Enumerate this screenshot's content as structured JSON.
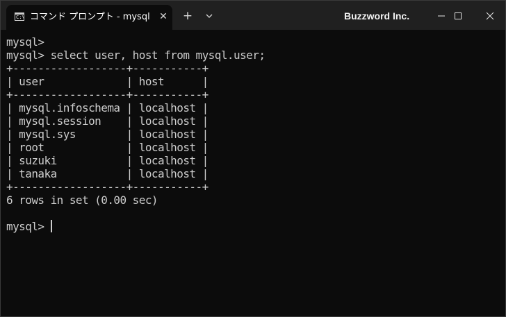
{
  "window": {
    "tab_title": "コマンド プロンプト - mysql  -u roo",
    "tab_close": "✕",
    "new_tab": "+",
    "organization": "Buzzword Inc."
  },
  "terminal": {
    "lines": [
      "mysql>",
      "mysql> select user, host from mysql.user;",
      "+------------------+-----------+",
      "| user             | host      |",
      "+------------------+-----------+",
      "| mysql.infoschema | localhost |",
      "| mysql.session    | localhost |",
      "| mysql.sys        | localhost |",
      "| root             | localhost |",
      "| suzuki           | localhost |",
      "| tanaka           | localhost |",
      "+------------------+-----------+",
      "6 rows in set (0.00 sec)",
      "",
      "mysql>"
    ]
  },
  "colors": {
    "background": "#0c0c0c",
    "titlebar": "#202020",
    "text": "#cccccc"
  }
}
